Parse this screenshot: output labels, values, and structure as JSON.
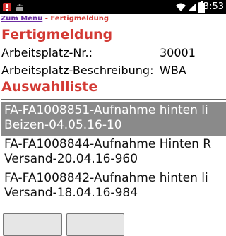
{
  "status_bar": {
    "time": "13:53",
    "icons": [
      "alert-icon",
      "android-icon",
      "wifi-icon",
      "signal-icon",
      "battery-icon"
    ]
  },
  "breadcrumb": {
    "link": "Zum Menu",
    "separator": " - ",
    "current": "Fertigmeldung"
  },
  "header": {
    "title": "Fertigmeldung"
  },
  "fields": [
    {
      "label": "Arbeitsplatz-Nr.:",
      "value": "30001"
    },
    {
      "label": "Arbeitsplatz-Beschreibung:",
      "value": "WBA"
    }
  ],
  "list": {
    "title": "Auswahlliste",
    "items": [
      {
        "text": "FA-FA1008851-Aufnahme hinten li\nBeizen-04.05.16-10",
        "selected": true
      },
      {
        "text": "FA-FA1008844-Aufnahme Hinten R\nVersand-20.04.16-960",
        "selected": false
      },
      {
        "text": "FA-FA1008842-Aufnahme hinten li\nVersand-18.04.16-984",
        "selected": false
      }
    ]
  },
  "colors": {
    "accent": "#d33a34",
    "link": "#6b2ca1",
    "selection": "#8a8a8a"
  }
}
